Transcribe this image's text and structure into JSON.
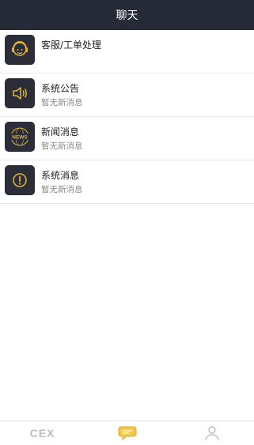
{
  "header": {
    "title": "聊天"
  },
  "colors": {
    "header_bg": "#262a36",
    "icon_bg": "#2b2e38",
    "accent": "#e0b13a",
    "muted": "#bdbdbd"
  },
  "chat_list": [
    {
      "icon": "headset-agent-icon",
      "title": "客服/工单处理",
      "subtitle": ""
    },
    {
      "icon": "speaker-icon",
      "title": "系统公告",
      "subtitle": "暂无新消息"
    },
    {
      "icon": "news-icon",
      "icon_text": "NEWS",
      "title": "新闻消息",
      "subtitle": "暂无新消息"
    },
    {
      "icon": "alert-circle-icon",
      "title": "系统消息",
      "subtitle": "暂无新消息"
    }
  ],
  "tab_bar": {
    "logo_text": "CEX",
    "tabs": [
      {
        "name": "home",
        "icon": "exchange-logo-icon"
      },
      {
        "name": "chat",
        "icon": "chat-bubble-icon",
        "active": true
      },
      {
        "name": "profile",
        "icon": "user-icon"
      }
    ]
  }
}
